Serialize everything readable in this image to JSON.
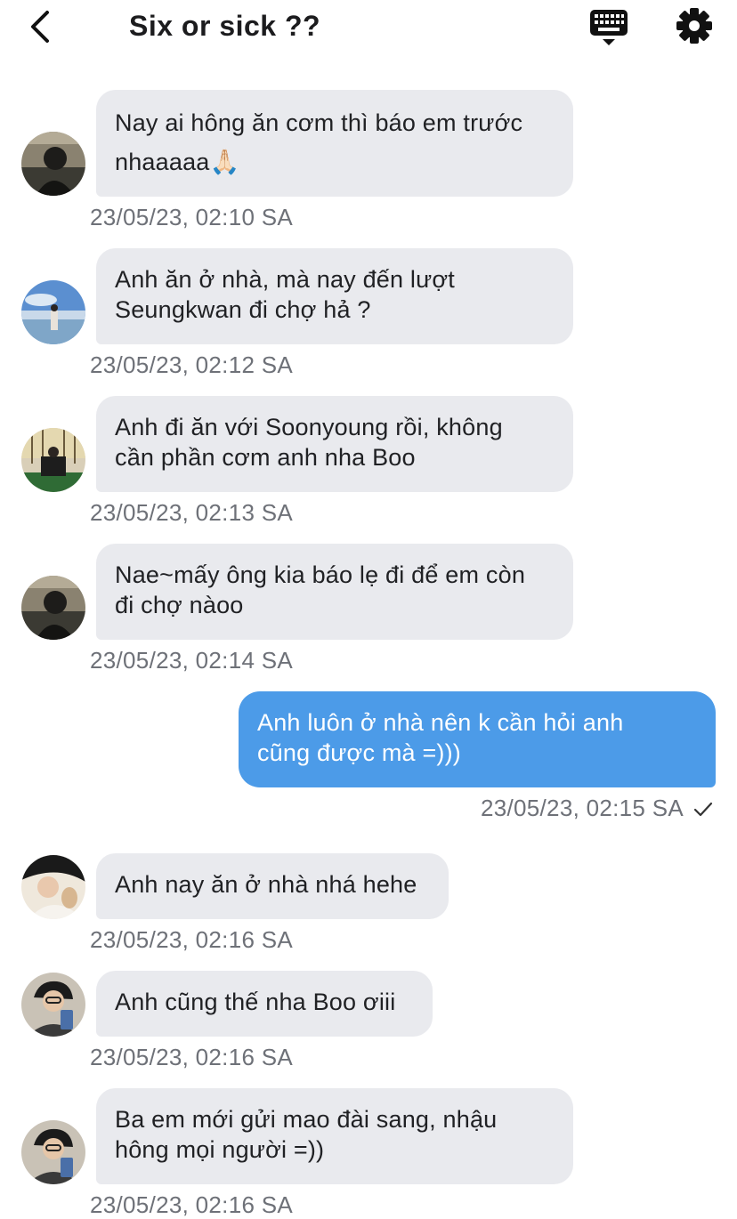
{
  "header": {
    "title": "Six or sick ??",
    "back_icon": "chevron-left-icon",
    "keyboard_icon": "keyboard-icon",
    "settings_icon": "gear-icon"
  },
  "colors": {
    "incoming_bubble": "#e9eaee",
    "outgoing_bubble": "#4c9be8",
    "timestamp": "#6e7178"
  },
  "messages": [
    {
      "direction": "in",
      "text": "Nay ai hông ăn cơm thì báo em trước\nnhaaaaa🙏🏻",
      "time": "23/05/23, 02:10 SA"
    },
    {
      "direction": "in",
      "text": "Anh ăn ở nhà, mà nay đến lượt\nSeungkwan đi chợ hả ?",
      "time": "23/05/23, 02:12 SA"
    },
    {
      "direction": "in",
      "text": "Anh đi ăn với Soonyoung rồi, không\ncần phần cơm anh nha Boo",
      "time": "23/05/23, 02:13 SA"
    },
    {
      "direction": "in",
      "text": "Nae~mấy ông kia báo lẹ đi để em còn\nđi chợ nàoo",
      "time": "23/05/23, 02:14 SA"
    },
    {
      "direction": "out",
      "text": "Anh luôn ở nhà nên k cần hỏi anh\ncũng được mà =)))",
      "time": "23/05/23, 02:15 SA",
      "status_icon": "check-icon"
    },
    {
      "direction": "in",
      "text": "Anh nay ăn ở nhà nhá hehe",
      "time": "23/05/23, 02:16 SA"
    },
    {
      "direction": "in",
      "text": "Anh cũng thế nha Boo ơiii",
      "time": "23/05/23, 02:16 SA"
    },
    {
      "direction": "in",
      "text": "Ba em mới gửi mao đài sang, nhậu\nhông mọi người =))",
      "time": "23/05/23, 02:16 SA"
    }
  ]
}
